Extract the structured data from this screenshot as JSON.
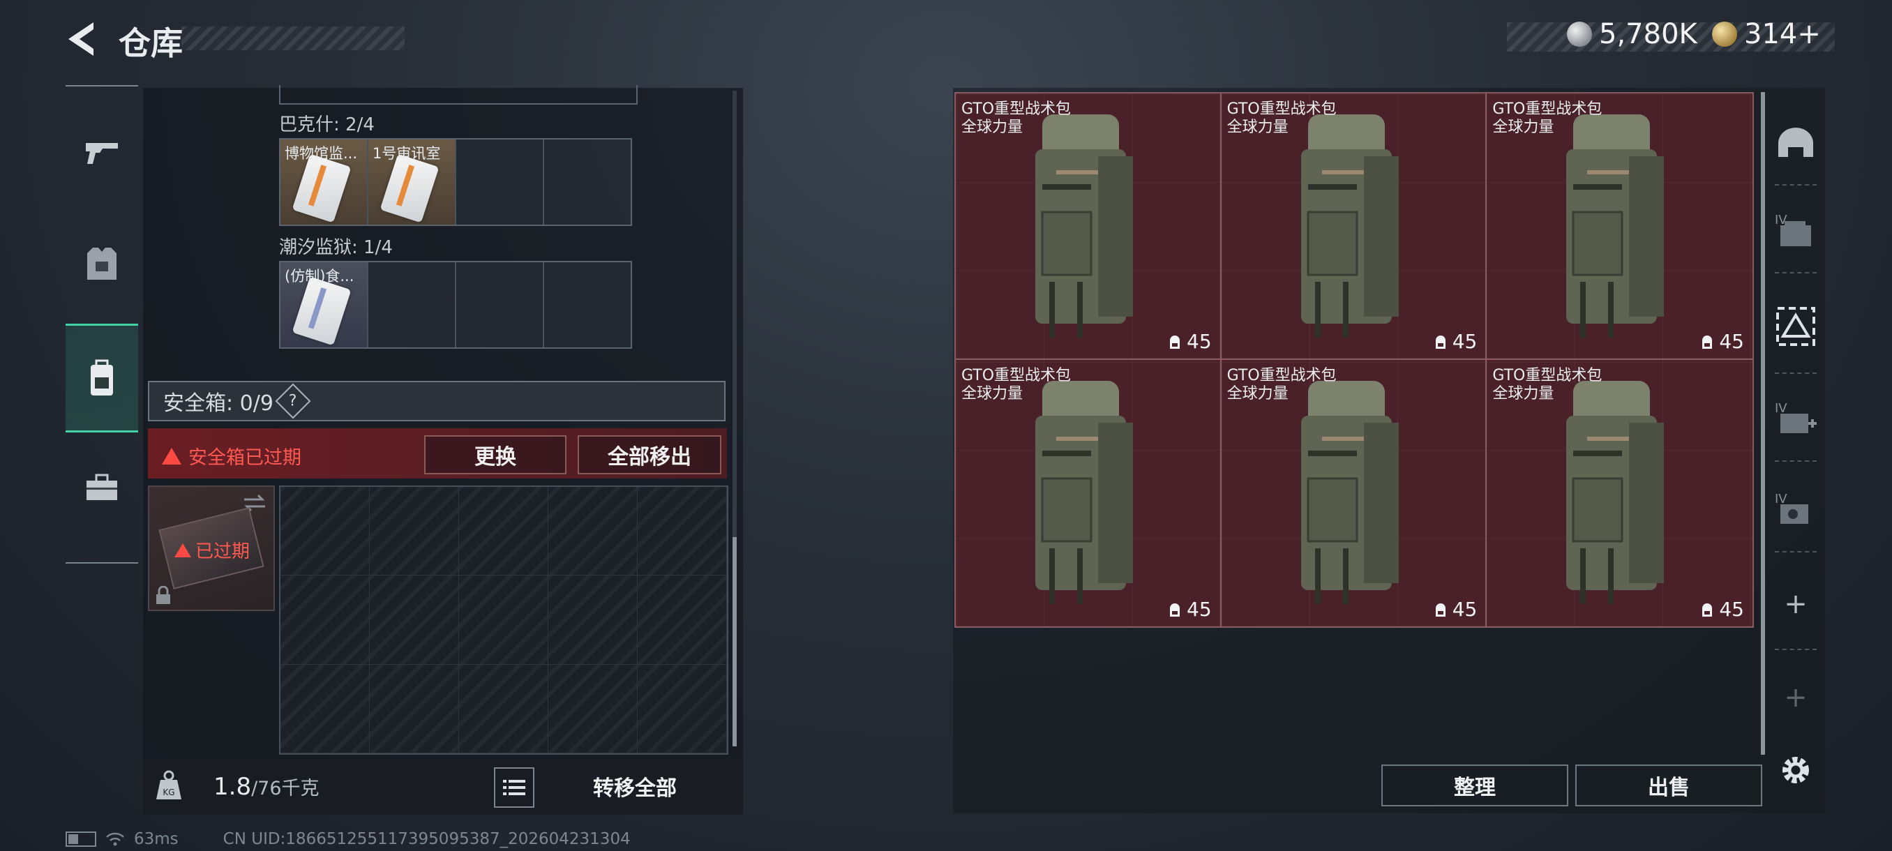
{
  "header": {
    "title": "仓库",
    "currency_silver": "5,780K",
    "currency_gold": "314+"
  },
  "nav": {
    "items": [
      {
        "name": "weapons"
      },
      {
        "name": "armor"
      },
      {
        "name": "backpack"
      },
      {
        "name": "supplies"
      }
    ],
    "active_index": 2
  },
  "storage": {
    "rows": [
      {
        "label": "巴克什: 2/4",
        "slots": [
          "博物馆监...",
          "1号审讯室",
          "",
          ""
        ]
      },
      {
        "label": "潮汐监狱: 1/4",
        "slots": [
          "(仿制)食...",
          "",
          "",
          ""
        ]
      }
    ]
  },
  "safe_box": {
    "header": "安全箱: 0/9",
    "help": "?",
    "expired_notice": "安全箱已过期",
    "replace_label": "更换",
    "remove_all_label": "全部移出",
    "icon_status": "已过期"
  },
  "footer_left": {
    "weight_value": "1.8",
    "weight_capacity": "/76千克",
    "transfer_all_label": "转移全部"
  },
  "status_bar": {
    "ping": "63ms",
    "uid": "CN UID:1866512551173950953​87_202604231304"
  },
  "items": [
    {
      "name": "GTO重型战术包",
      "subtitle": "全球力量",
      "capacity": "45"
    },
    {
      "name": "GTO重型战术包",
      "subtitle": "全球力量",
      "capacity": "45"
    },
    {
      "name": "GTO重型战术包",
      "subtitle": "全球力量",
      "capacity": "45"
    },
    {
      "name": "GTO重型战术包",
      "subtitle": "全球力量",
      "capacity": "45"
    },
    {
      "name": "GTO重型战术包",
      "subtitle": "全球力量",
      "capacity": "45"
    },
    {
      "name": "GTO重型战术包",
      "subtitle": "全球力量",
      "capacity": "45"
    }
  ],
  "side_tools": {
    "tier_labels": [
      "IV",
      "IV",
      "IV"
    ],
    "add_label": "+"
  },
  "actions": {
    "sort_label": "整理",
    "sell_label": "出售"
  }
}
